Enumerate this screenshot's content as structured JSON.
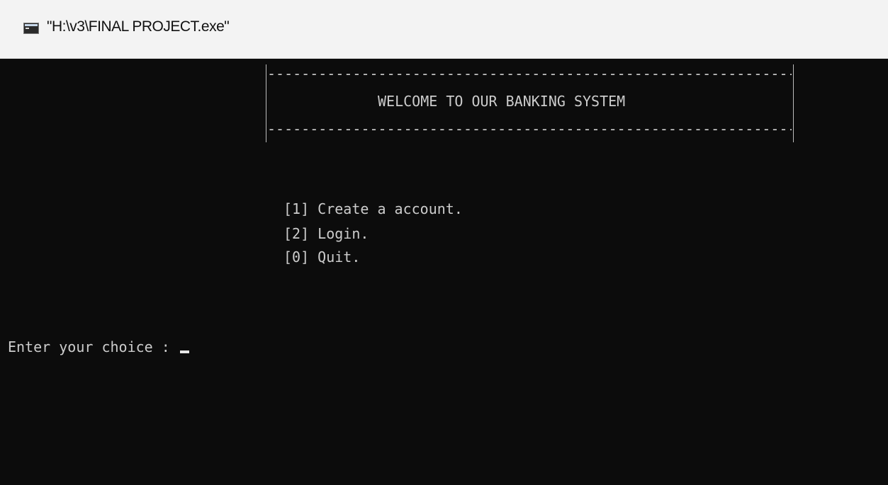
{
  "window": {
    "title": "\"H:\\v3\\FINAL PROJECT.exe\"",
    "icon": "console-app-icon"
  },
  "console": {
    "border_dashes": "----------------------------------------------------------------------",
    "banner": "WELCOME TO OUR BANKING SYSTEM",
    "menu": [
      {
        "label": "[1] Create a account."
      },
      {
        "label": "[2] Login."
      },
      {
        "label": "[0] Quit."
      }
    ],
    "prompt": "Enter your choice : "
  },
  "colors": {
    "background": "#0c0c0c",
    "text": "#cccccc",
    "titlebar": "#f3f3f3"
  }
}
